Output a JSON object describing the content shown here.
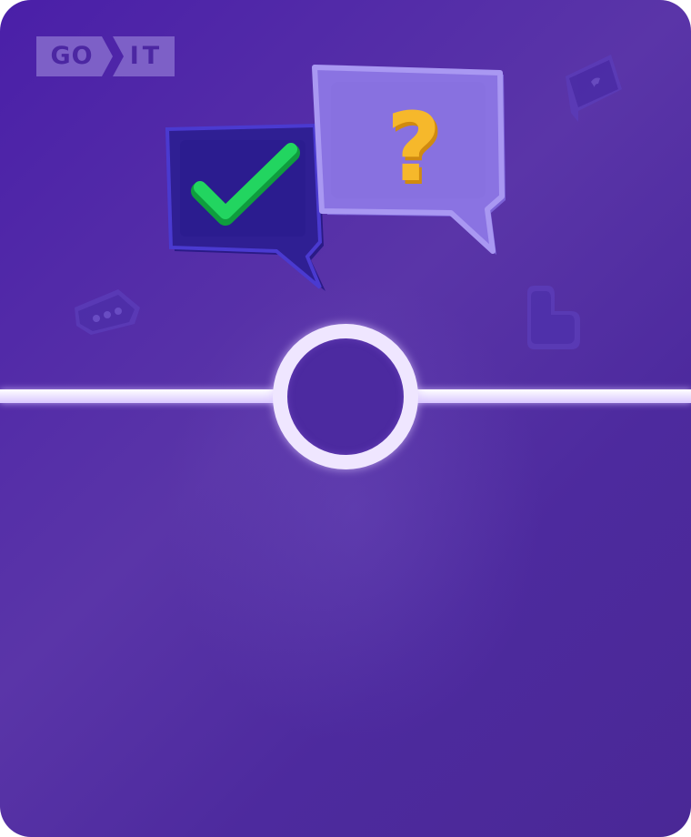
{
  "brand": {
    "logo_left": "GO",
    "logo_right": "IT"
  },
  "illustration": {
    "answer_bubble_icon": "checkmark-icon",
    "question_bubble_icon": "question-mark-icon",
    "question_glyph": "?"
  },
  "colors": {
    "background": "#4a1fa8",
    "logo": "#7d60c7",
    "check": "#1fd05a",
    "question": "#f6b82b",
    "divider": "#efe6ff"
  }
}
